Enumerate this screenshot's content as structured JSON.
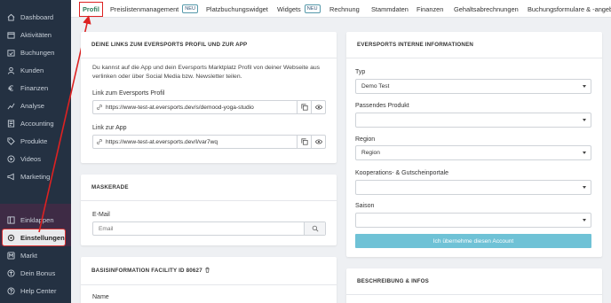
{
  "sidebar": {
    "items": [
      {
        "label": "Dashboard"
      },
      {
        "label": "Aktivitäten"
      },
      {
        "label": "Buchungen"
      },
      {
        "label": "Kunden"
      },
      {
        "label": "Finanzen"
      },
      {
        "label": "Analyse"
      },
      {
        "label": "Accounting"
      },
      {
        "label": "Produkte"
      },
      {
        "label": "Videos"
      },
      {
        "label": "Marketing"
      }
    ],
    "bottom_items": [
      {
        "label": "Einklappen"
      },
      {
        "label": "Einstellungen"
      },
      {
        "label": "Markt"
      },
      {
        "label": "Dein Bonus"
      },
      {
        "label": "Help Center"
      }
    ]
  },
  "topnav": {
    "tabs": [
      {
        "label": "Profil"
      },
      {
        "label": "Preislistenmanagement",
        "badge": "NEU"
      },
      {
        "label": "Platzbuchungswidget"
      },
      {
        "label": "Widgets",
        "badge": "NEU"
      },
      {
        "label": "Rechnung"
      },
      {
        "label": "Stammdaten"
      },
      {
        "label": "Finanzen"
      },
      {
        "label": "Gehaltsabrechnungen"
      },
      {
        "label": "Buchungsformulare & -angebo"
      }
    ]
  },
  "links_card": {
    "title": "DEINE LINKS ZUM EVERSPORTS PROFIL UND ZUR APP",
    "description": "Du kannst auf die App und dein Eversports Marktplatz Profil von deiner Webseite aus verlinken oder über Social Media bzw. Newsletter teilen.",
    "profile_label": "Link zum Eversports Profil",
    "profile_url": "https://www-test-at.eversports.dev/s/demood-yoga-studio",
    "app_label": "Link zur App",
    "app_url": "https://www-test-at.eversports.dev/l/var7wq"
  },
  "maskerade_card": {
    "title": "MASKERADE",
    "email_label": "E-Mail",
    "email_placeholder": "Email"
  },
  "basis_card": {
    "title": "BASISINFORMATION FACILITY ID 80627",
    "name_label": "Name"
  },
  "internal_card": {
    "title": "EVERSPORTS INTERNE INFORMATIONEN",
    "typ_label": "Typ",
    "typ_value": "Demo Test",
    "produkt_label": "Passendes Produkt",
    "produkt_value": "",
    "region_label": "Region",
    "region_value": "Region",
    "koop_label": "Kooperations- & Gutscheinportale",
    "koop_value": "",
    "saison_label": "Saison",
    "saison_value": "",
    "button_label": "Ich übernehme diesen Account"
  },
  "beschreibung_card": {
    "title": "BESCHREIBUNG & INFOS"
  },
  "colors": {
    "sidebar_bg": "#243142",
    "accent_green": "#2e7d5b",
    "highlight_red": "#d22222",
    "button_blue": "#6fc2d6"
  }
}
